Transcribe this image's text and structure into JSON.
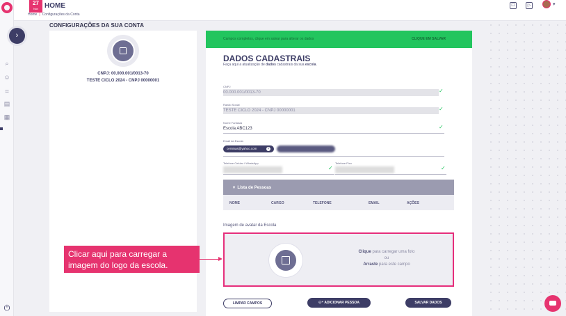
{
  "topbar": {
    "day": "27",
    "month": "Nov",
    "title": "HOME",
    "breadcrumb": [
      "Home",
      "Configurações da Conta"
    ]
  },
  "page": {
    "title": "CONFIGURAÇÕES DA SUA CONTA"
  },
  "profile": {
    "cnpj_line": "CNPJ: 00.000.001/0013-70",
    "name_line": "TESTE CICLO 2024 - CNPJ 00000001"
  },
  "banner": {
    "message": "Campos completos, clique em salvar para alterar os dados",
    "action": "CLIQUE EM SALVAR"
  },
  "form": {
    "title": "DADOS CADASTRAIS",
    "subtitle_prefix": "Faça aqui a atualização de ",
    "subtitle_bold1": "dados",
    "subtitle_mid": " cadastrais da sua ",
    "subtitle_bold2": "escola",
    "subtitle_suffix": ".",
    "cnpj_label": "CNPJ",
    "cnpj_value": "00.000.001/0013-70",
    "razao_label": "Razão Social",
    "razao_value": "TESTE CICLO 2024 - CNPJ 00000001",
    "fantasia_label": "Nome Fantasia",
    "fantasia_value": "Escola ABC123",
    "email_label": "Email da Escola",
    "email_chip": "ceminas@yahoo.com",
    "celular_label": "Telefone Celular / WhatsApp",
    "fixo_label": "Telefone Fixo"
  },
  "people": {
    "title": "Lista de Pessoas",
    "columns": [
      "NOME",
      "CARGO",
      "TELEFONE",
      "EMAIL",
      "AÇÕES"
    ]
  },
  "avatar_upload": {
    "label": "Imagem de avatar da Escola",
    "click_bold": "Clique",
    "click_rest": " para carregar uma foto",
    "or": "ou",
    "drag_bold": "Arraste",
    "drag_rest": " para este campo"
  },
  "buttons": {
    "clear": "LIMPAR CAMPOS",
    "add_person": "ADICIONAR PESSOA",
    "save": "SALVAR DADOS"
  },
  "callout": {
    "text": "Clicar aqui para carregar a imagem do logo da escola."
  },
  "colors": {
    "accent": "#e6336f",
    "primary": "#3d3d66",
    "success": "#22c55e"
  }
}
